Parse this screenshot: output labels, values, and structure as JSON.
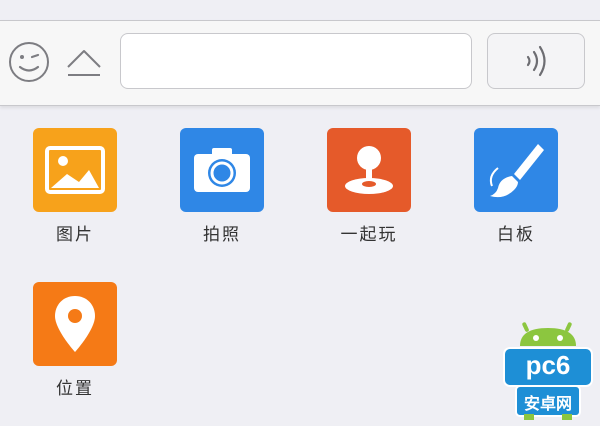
{
  "input_bar": {
    "emoji_icon": "smiley-icon",
    "keyboard_toggle_icon": "chevron-up-icon",
    "text_value": "",
    "voice_icon": "sound-wave-icon"
  },
  "panel": {
    "items": [
      {
        "label": "图片",
        "icon": "image-icon",
        "color": "#f7a21b"
      },
      {
        "label": "拍照",
        "icon": "camera-icon",
        "color": "#2f87e6"
      },
      {
        "label": "一起玩",
        "icon": "joystick-icon",
        "color": "#e55a2a"
      },
      {
        "label": "白板",
        "icon": "brush-icon",
        "color": "#2f87e6"
      },
      {
        "label": "位置",
        "icon": "location-pin-icon",
        "color": "#f57a16"
      }
    ]
  },
  "watermark": {
    "brand": "pc6",
    "subtitle": "安卓网",
    "colors": {
      "primary": "#1e8fd6",
      "robot": "#8cc63f"
    }
  }
}
